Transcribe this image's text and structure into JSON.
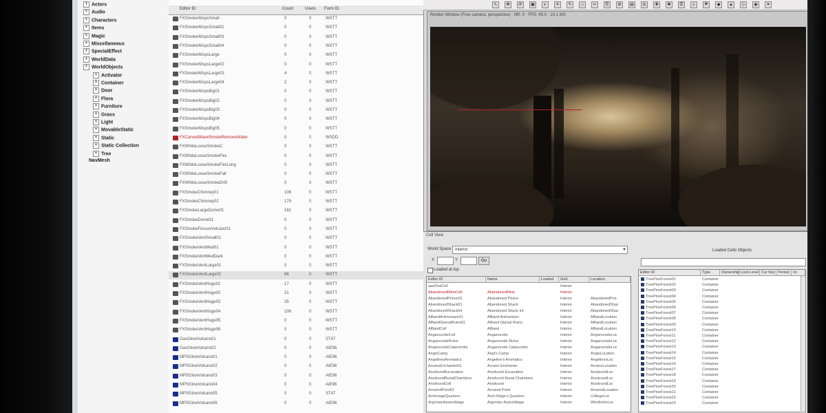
{
  "tree": {
    "items": [
      "Actors",
      "Audio",
      "Characters",
      "Items",
      "Magic",
      "Miscellaneous",
      "SpecialEffect",
      "WorldData",
      "WorldObjects",
      "Activator",
      "Container",
      "Door",
      "Flora",
      "Furniture",
      "Grass",
      "Light",
      "MovableStatic",
      "Static",
      "Static Collection",
      "Tree",
      "NavMesh"
    ]
  },
  "object_list": {
    "header": [
      "Editor ID",
      "Count",
      "Users",
      "Form ID"
    ],
    "rows": [
      [
        "FXSmokeWispsSmall",
        "0",
        "0",
        "WSTT"
      ],
      [
        "FXSmokeWispsSmall02",
        "0",
        "0",
        "WSTT"
      ],
      [
        "FXSmokeWispsSmall03",
        "0",
        "0",
        "WSTT"
      ],
      [
        "FXSmokeWispsSmall04",
        "0",
        "0",
        "WSTT"
      ],
      [
        "FXSmokeWispsLarge",
        "0",
        "0",
        "WSTT"
      ],
      [
        "FXSmokeWispsLarge02",
        "0",
        "0",
        "WSTT"
      ],
      [
        "FXSmokeWispsLarge03",
        "4",
        "0",
        "WSTT"
      ],
      [
        "FXSmokeWispsLarge04",
        "2",
        "0",
        "WSTT"
      ],
      [
        "FXSmokeWispsBig01",
        "0",
        "0",
        "WSTT"
      ],
      [
        "FXSmokeWispsBig02",
        "0",
        "0",
        "WSTT"
      ],
      [
        "FXSmokeWispsBig03",
        "0",
        "0",
        "WSTT"
      ],
      [
        "FXSmokeWispsBig04",
        "0",
        "0",
        "WSTT"
      ],
      [
        "FXSmokeWispsBig05",
        "0",
        "0",
        "WSTT"
      ],
      [
        "FXCarvedWaveSmokeRemoveWater",
        "0",
        "0",
        "WSDD"
      ],
      [
        "FXWhiteLooseSmokeC",
        "0",
        "0",
        "WSTT"
      ],
      [
        "FXWhiteLooseSmokeFire",
        "0",
        "0",
        "WSTT"
      ],
      [
        "FXWhiteLooseSmokeFireLong",
        "0",
        "0",
        "WSTT"
      ],
      [
        "FXWhiteLooseSmokeFall",
        "0",
        "0",
        "WSTT"
      ],
      [
        "FXWhiteLooseSmokeDrift",
        "0",
        "0",
        "WSTT"
      ],
      [
        "FXSmokeChimney01",
        "106",
        "0",
        "WSTT"
      ],
      [
        "FXSmokeChimney02",
        "179",
        "0",
        "WSTT"
      ],
      [
        "FXSmokeLargeDome01",
        "162",
        "0",
        "WSTT"
      ],
      [
        "FXSmokeDome01",
        "0",
        "0",
        "WSTT"
      ],
      [
        "FXSmokeFissureVolcano01",
        "0",
        "0",
        "WSTT"
      ],
      [
        "FXSmokeVentSmall01",
        "0",
        "0",
        "WSTT"
      ],
      [
        "FXSmokeVentMed01",
        "0",
        "0",
        "WSTT"
      ],
      [
        "FXSmokeVentMedDark",
        "0",
        "0",
        "WSTT"
      ],
      [
        "FXSmokeVentLarge01",
        "0",
        "0",
        "WSTT"
      ],
      [
        "FXSmokeVentLarge02",
        "96",
        "0",
        "WSTT"
      ],
      [
        "FXSmokeVentHuge01",
        "17",
        "0",
        "WSTT"
      ],
      [
        "FXSmokeVentHuge02",
        "31",
        "0",
        "WSTT"
      ],
      [
        "FXSmokeVentHuge03",
        "35",
        "0",
        "WSTT"
      ],
      [
        "FXSmokeVentHuge04",
        "106",
        "0",
        "WSTT"
      ],
      [
        "FXSmokeVentHuge05",
        "0",
        "0",
        "WSTT"
      ],
      [
        "FXSmokeVentHuge06",
        "0",
        "0",
        "WSTT"
      ],
      [
        "GasGlowVolcano01",
        "0",
        "0",
        "ST47"
      ],
      [
        "GasGlowVolcano02",
        "0",
        "0",
        "AIE96"
      ],
      [
        "MPSGlowVolcano01",
        "0",
        "0",
        "AIE96"
      ],
      [
        "MPSGlowVolcano02",
        "0",
        "0",
        "AIE96"
      ],
      [
        "MPSGlowVolcano03",
        "0",
        "0",
        "AIE96"
      ],
      [
        "MPSGlowVolcano04",
        "0",
        "0",
        "AIE96"
      ],
      [
        "MPSGlowVolcano05",
        "0",
        "0",
        "ST47"
      ],
      [
        "MPSGlowVolcano06",
        "0",
        "0",
        "AIE96"
      ]
    ]
  },
  "render_window": {
    "title": "Render Window (Free camera, perspective) · NR: 0 · FPS: 45.0 · 10.1 MS"
  },
  "cell_view": {
    "title": "Cell View",
    "world_space_label": "World Space",
    "world_space_value": "Interior",
    "x_label": "X",
    "y_label": "Y",
    "go_label": "Go",
    "loaded_at_top_label": "Loaded at top",
    "columns": [
      "Editor ID",
      "Name",
      "Loaded",
      "Grid",
      "Location"
    ],
    "rows": [
      [
        "aaaTestCell",
        "",
        "",
        "Interior",
        ""
      ],
      [
        "AbandonedMineCell",
        "AbandonedMine",
        "",
        "Interior",
        ""
      ],
      [
        "AbandonedPrison01",
        "Abandoned Prison",
        "",
        "Interior",
        "AbandonedPris"
      ],
      [
        "AbandonedShack01",
        "Abandoned Shack",
        "",
        "Interior",
        "AbandonedShac"
      ],
      [
        "AbandonedShackInt",
        "Abandoned Shack Int",
        "",
        "Interior",
        "AbandonedShac"
      ],
      [
        "AlftandAnimonium01",
        "Alftand Animonium",
        "",
        "Interior",
        "AlftandLocation"
      ],
      [
        "AlftandGlacialRuins01",
        "Alftand Glacial Ruins",
        "",
        "Interior",
        "AlftandLocation"
      ],
      [
        "AlftandCell",
        "Alftand",
        "",
        "Interior",
        "AlftandLocation"
      ],
      [
        "AngarvundeCell",
        "Angarvunde",
        "",
        "Interior",
        "AngarvundeLoc"
      ],
      [
        "AngarvundeRuins",
        "Angarvunde Ruins",
        "",
        "Interior",
        "AngarvundeLoc"
      ],
      [
        "AngarvundeCatacombs",
        "Angarvunde Catacombs",
        "",
        "Interior",
        "AngarvundeLoc"
      ],
      [
        "AngisCamp",
        "Angi's Camp",
        "",
        "Interior",
        "AngisLocation"
      ],
      [
        "AngelinesAromatics",
        "Angeline's Aromatics",
        "",
        "Interior",
        "AngelinesLoc"
      ],
      [
        "ArcaneEnchanter01",
        "Arcane Enchanter",
        "",
        "Interior",
        "ArcaneLocation"
      ],
      [
        "AnsilvundExcavation",
        "Ansilvund Excavation",
        "",
        "Interior",
        "AnsilvundLoc"
      ],
      [
        "AnsilvundBurialChambers",
        "Ansilvund Burial Chambers",
        "",
        "Interior",
        "AnsilvundLoc"
      ],
      [
        "AnsilvundCell",
        "Ansilvund",
        "",
        "Interior",
        "AnsilvundLoc"
      ],
      [
        "ArcwindPoint01",
        "Arcwind Point",
        "",
        "Interior",
        "ArcwindLocation"
      ],
      [
        "ArchmageQuarters",
        "Arch-Mage's Quarters",
        "",
        "Interior",
        "CollegeLoc"
      ],
      [
        "ArgonianAssemblage",
        "Argonian Assemblage",
        "",
        "Interior",
        "WindhelmLoc"
      ]
    ],
    "loaded_title": "Loaded Cells Objects",
    "ref_columns": [
      "Editor ID",
      "Type",
      "Ownership",
      "Lock Level",
      "Cur Key",
      "Persist",
      "Ini"
    ],
    "ref_rows": [
      [
        "TreePineForest01",
        "Container"
      ],
      [
        "TreePineForest02",
        "Container"
      ],
      [
        "TreePineForest03",
        "Container"
      ],
      [
        "TreePineForest04",
        "Container"
      ],
      [
        "TreePineForest05",
        "Container"
      ],
      [
        "TreePineForest06",
        "Container"
      ],
      [
        "TreePineForest07",
        "Container"
      ],
      [
        "TreePineForest08",
        "Container"
      ],
      [
        "TreePineForest09",
        "Container"
      ],
      [
        "TreePineForest10",
        "Container"
      ],
      [
        "TreePineForest11",
        "Container"
      ],
      [
        "TreePineForest12",
        "Container"
      ],
      [
        "TreePineForest13",
        "Container"
      ],
      [
        "TreePineForest14",
        "Container"
      ],
      [
        "TreePineForest15",
        "Container"
      ],
      [
        "TreePineForest16",
        "Container"
      ],
      [
        "TreePineForest17",
        "Container"
      ],
      [
        "TreePineForest18",
        "Container"
      ],
      [
        "TreePineForest19",
        "Container"
      ],
      [
        "TreePineForest20",
        "Container"
      ],
      [
        "TreePineForest21",
        "Container"
      ],
      [
        "TreePineForest22",
        "Container"
      ],
      [
        "TreePineForest23",
        "Container"
      ]
    ]
  },
  "colors": {
    "red_row": "#c0202a",
    "screen_bg": "#d9dadc",
    "viewport_glow": "#d8c49a"
  }
}
